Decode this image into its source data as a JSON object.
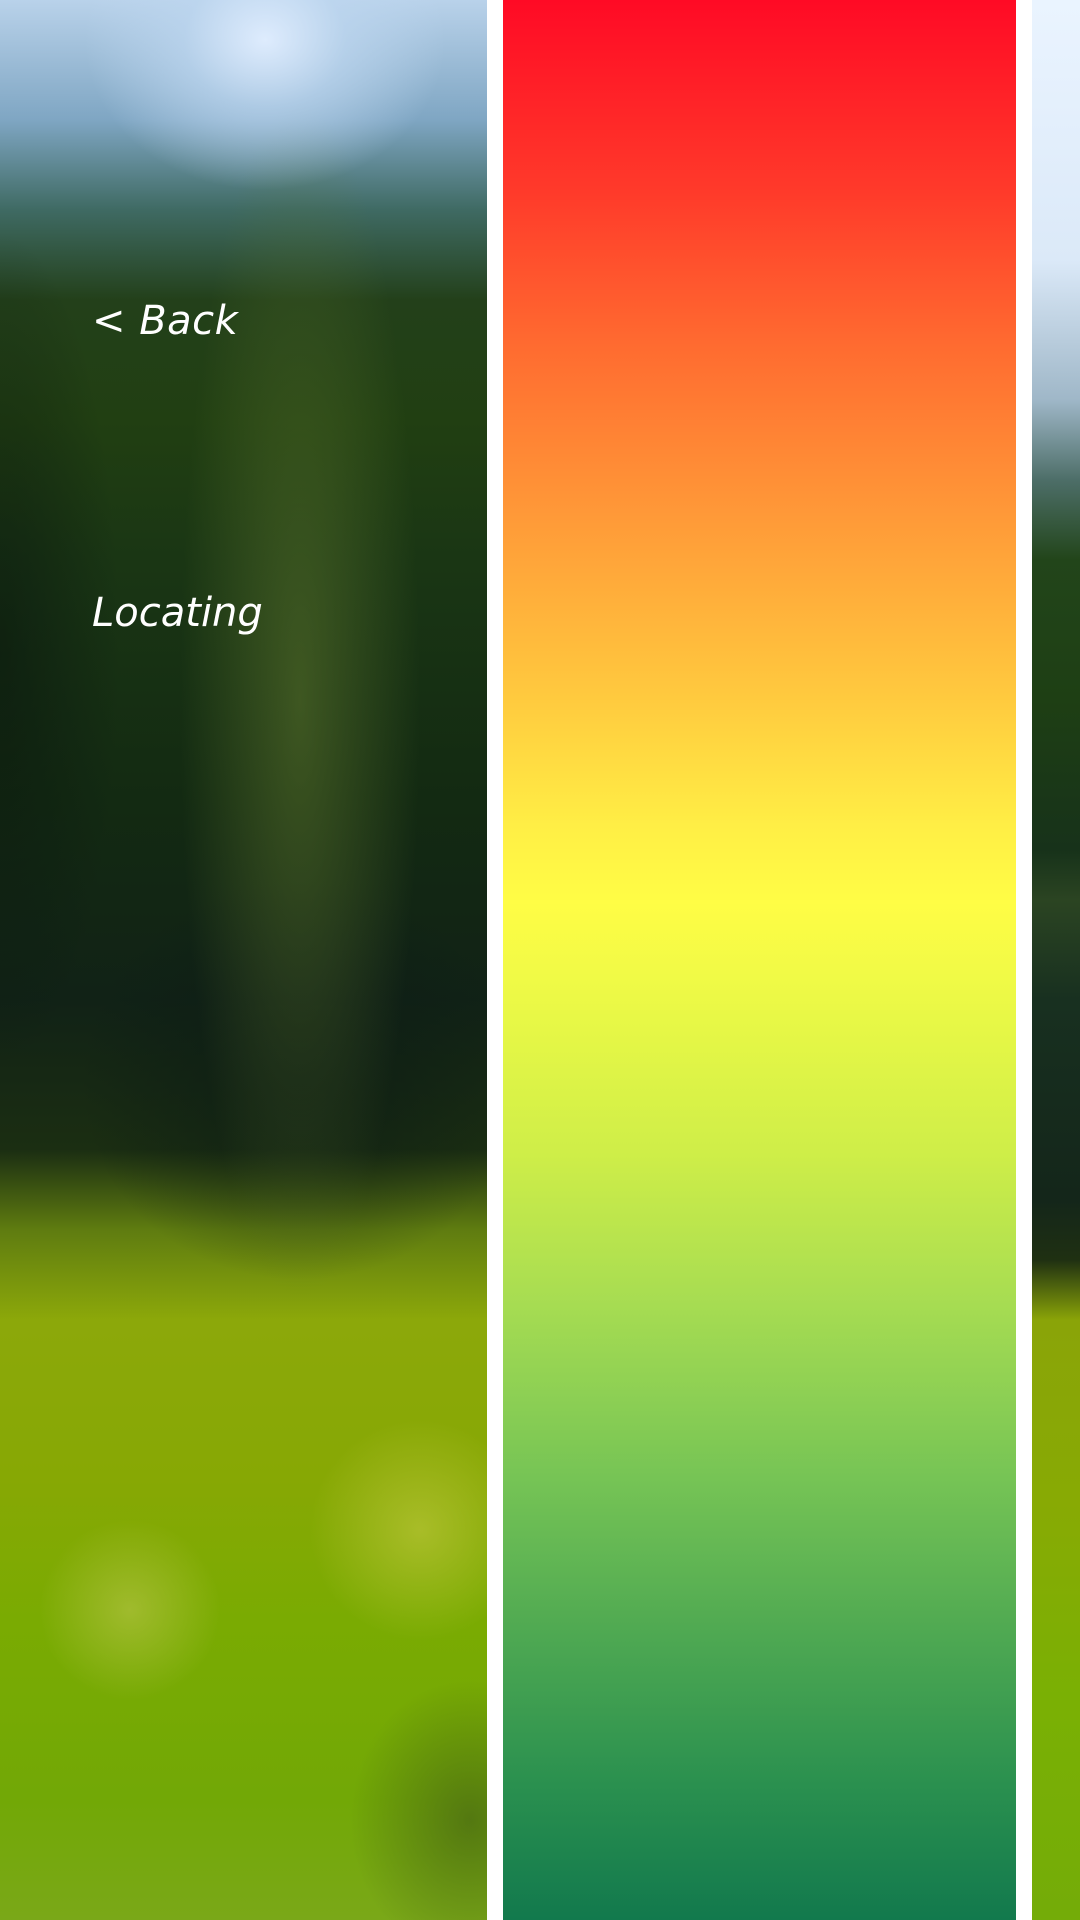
{
  "header": {
    "back_label": "< Back"
  },
  "status": {
    "text": "Locating"
  },
  "indicator": {
    "icon": "color-scale-bar",
    "colors": {
      "top": "#ff0a25",
      "orange": "#ff8c35",
      "yellow": "#fffd45",
      "light_green": "#a6dc52",
      "bottom": "#12794d"
    }
  }
}
